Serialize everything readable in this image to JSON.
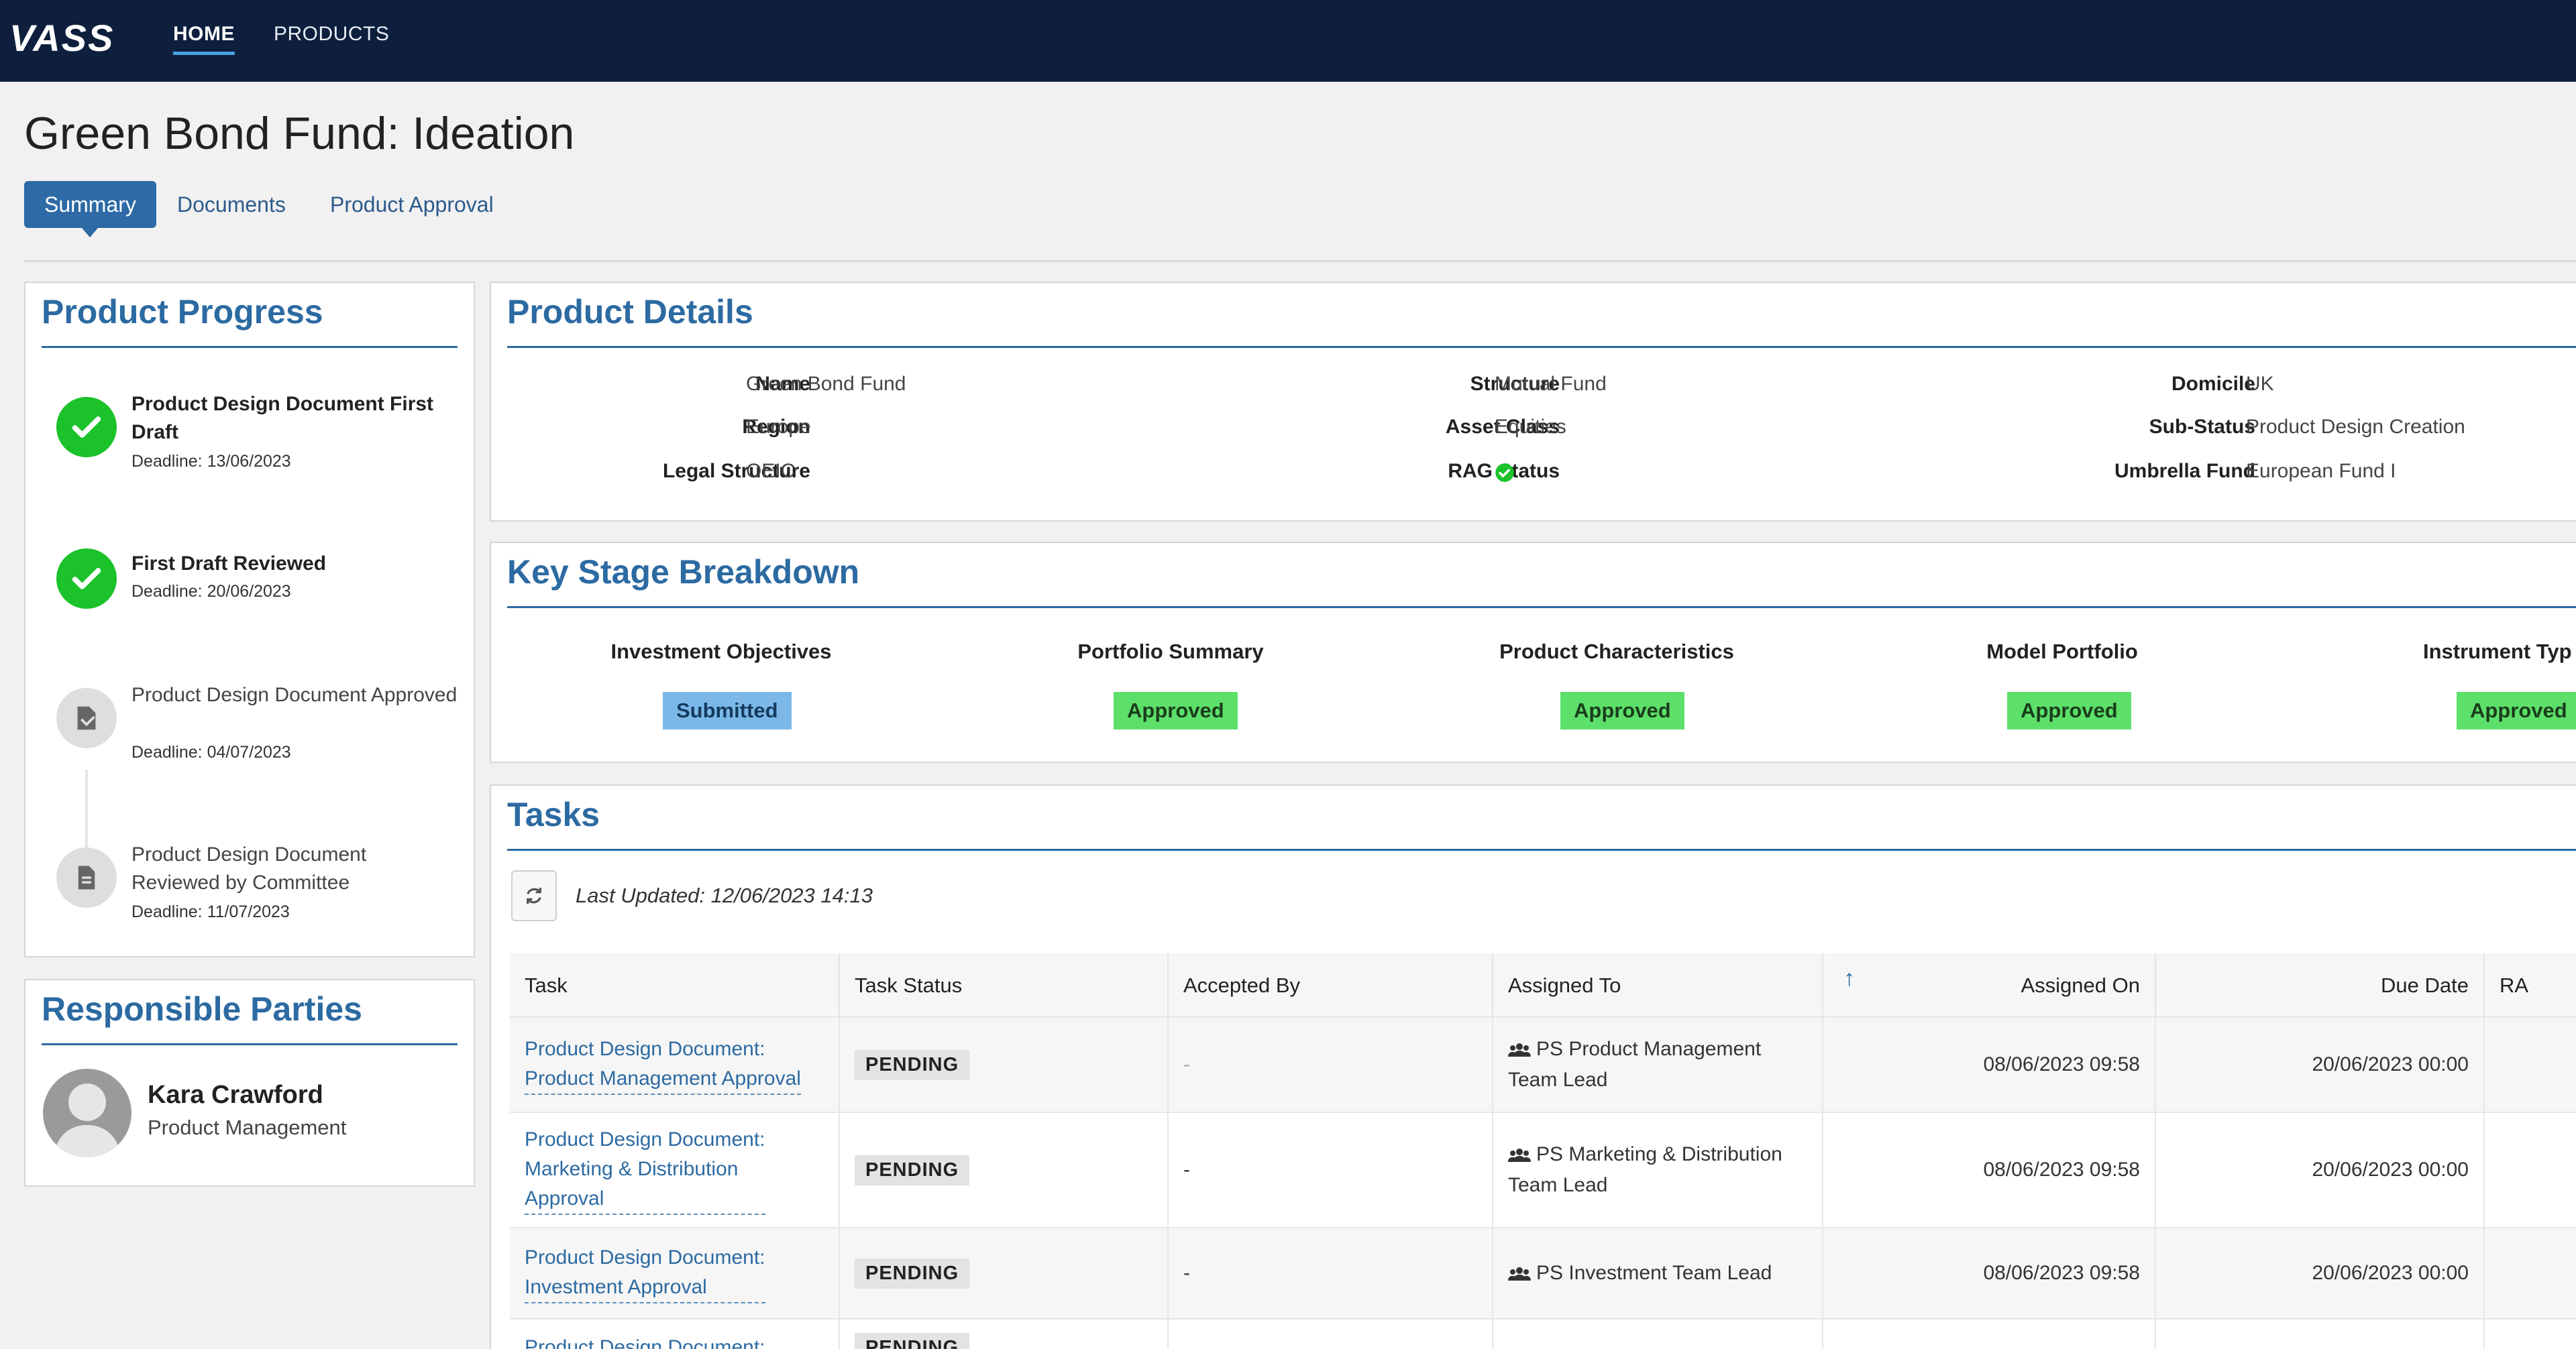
{
  "nav": {
    "logo": "VASS",
    "items": [
      "HOME",
      "PRODUCTS"
    ]
  },
  "page": {
    "title": "Green Bond Fund: Ideation",
    "tabs": [
      "Summary",
      "Documents",
      "Product Approval"
    ]
  },
  "progress": {
    "title": "Product Progress",
    "steps": [
      {
        "label": "Product Design Document First Draft",
        "deadline": "Deadline: 13/06/2023",
        "state": "done"
      },
      {
        "label": "First Draft Reviewed",
        "deadline": "Deadline: 20/06/2023",
        "state": "done"
      },
      {
        "label": "Product Design Document Approved",
        "deadline": "Deadline: 04/07/2023",
        "state": "pending"
      },
      {
        "label": "Product Design Document Reviewed by Committee",
        "deadline": "Deadline: 11/07/2023",
        "state": "pending"
      }
    ]
  },
  "responsible": {
    "title": "Responsible Parties",
    "name": "Kara Crawford",
    "role": "Product Management"
  },
  "details": {
    "title": "Product Details",
    "name_label": "Name",
    "name_value": "Green Bond Fund",
    "region_label": "Region",
    "region_value": "Europe",
    "legal_label": "Legal Structure",
    "legal_value": "OEIC",
    "structure_label": "Structure",
    "structure_value": "Mutual Fund",
    "asset_label": "Asset Class",
    "asset_value": "Equities",
    "rag_label": "RAG Status",
    "rag_color": "#1bc22a",
    "domicile_label": "Domicile",
    "domicile_value": "UK",
    "substatus_label": "Sub-Status",
    "substatus_value": "Product Design Creation",
    "umbrella_label": "Umbrella Fund",
    "umbrella_value": "European Fund I"
  },
  "stages": {
    "title": "Key Stage Breakdown",
    "items": [
      {
        "label": "Investment Objectives",
        "status": "Submitted"
      },
      {
        "label": "Portfolio Summary",
        "status": "Approved"
      },
      {
        "label": "Product Characteristics",
        "status": "Approved"
      },
      {
        "label": "Model Portfolio",
        "status": "Approved"
      },
      {
        "label": "Instrument Typ",
        "status": "Approved"
      }
    ]
  },
  "tasks": {
    "title": "Tasks",
    "last_updated": "Last Updated: 12/06/2023 14:13",
    "columns": [
      "Task",
      "Task Status",
      "Accepted By",
      "Assigned To",
      "Assigned On",
      "Due Date",
      "RA"
    ],
    "sort_arrow": "↑",
    "rows": [
      {
        "task": [
          "Product Design Document:",
          "Product Management Approval"
        ],
        "status": "PENDING",
        "accepted": "-",
        "assigned_to": [
          "PS Product Management",
          "Team Lead"
        ],
        "assigned_on": "08/06/2023 09:58",
        "due": "20/06/2023 00:00"
      },
      {
        "task": [
          "Product Design Document:",
          "Marketing & Distribution",
          "Approval"
        ],
        "status": "PENDING",
        "accepted": "-",
        "assigned_to": [
          "PS Marketing & Distribution",
          "Team Lead"
        ],
        "assigned_on": "08/06/2023 09:58",
        "due": "20/06/2023 00:00"
      },
      {
        "task": [
          "Product Design Document:",
          "Investment Approval"
        ],
        "status": "PENDING",
        "accepted": "-",
        "assigned_to": [
          "PS Investment Team Lead"
        ],
        "assigned_on": "08/06/2023 09:58",
        "due": "20/06/2023 00:00"
      },
      {
        "task": [
          "Product Design Document:"
        ],
        "status": "PENDING",
        "accepted": "-",
        "assigned_to": [
          ""
        ],
        "assigned_on": "",
        "due": ""
      }
    ]
  }
}
